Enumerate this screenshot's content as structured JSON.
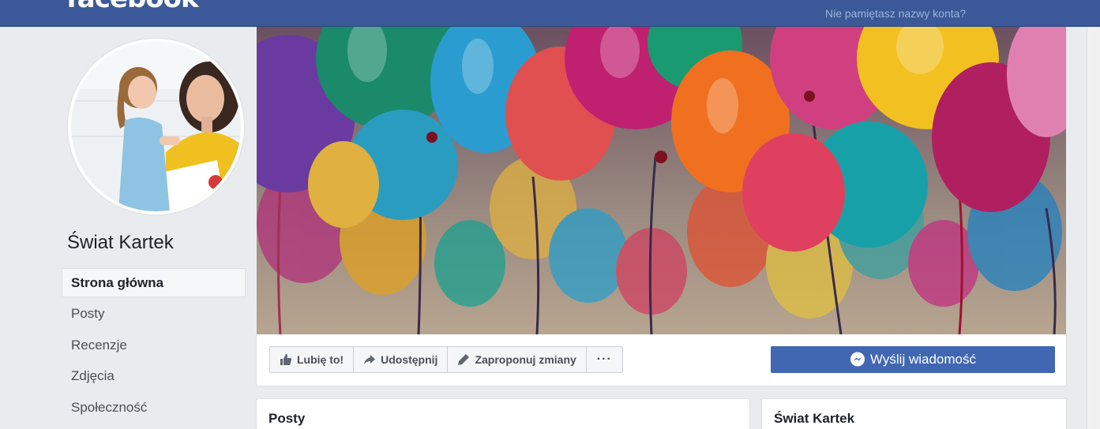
{
  "header": {
    "logo": "facebook",
    "forgot_account": "Nie pamiętasz nazwy konta?"
  },
  "page": {
    "name": "Świat Kartek"
  },
  "sidebar": {
    "items": [
      {
        "label": "Strona główna",
        "active": true
      },
      {
        "label": "Posty"
      },
      {
        "label": "Recenzje"
      },
      {
        "label": "Zdjęcia"
      },
      {
        "label": "Społeczność"
      }
    ]
  },
  "actions": {
    "like": "Lubię to!",
    "share": "Udostępnij",
    "suggest": "Zaproponuj zmiany",
    "more": "···",
    "send_message": "Wyślij wiadomość"
  },
  "cards": {
    "posts_title": "Posty",
    "about_title": "Świat Kartek"
  },
  "colors": {
    "brand": "#3b5998",
    "button": "#4267b2",
    "background": "#e9ebee"
  }
}
